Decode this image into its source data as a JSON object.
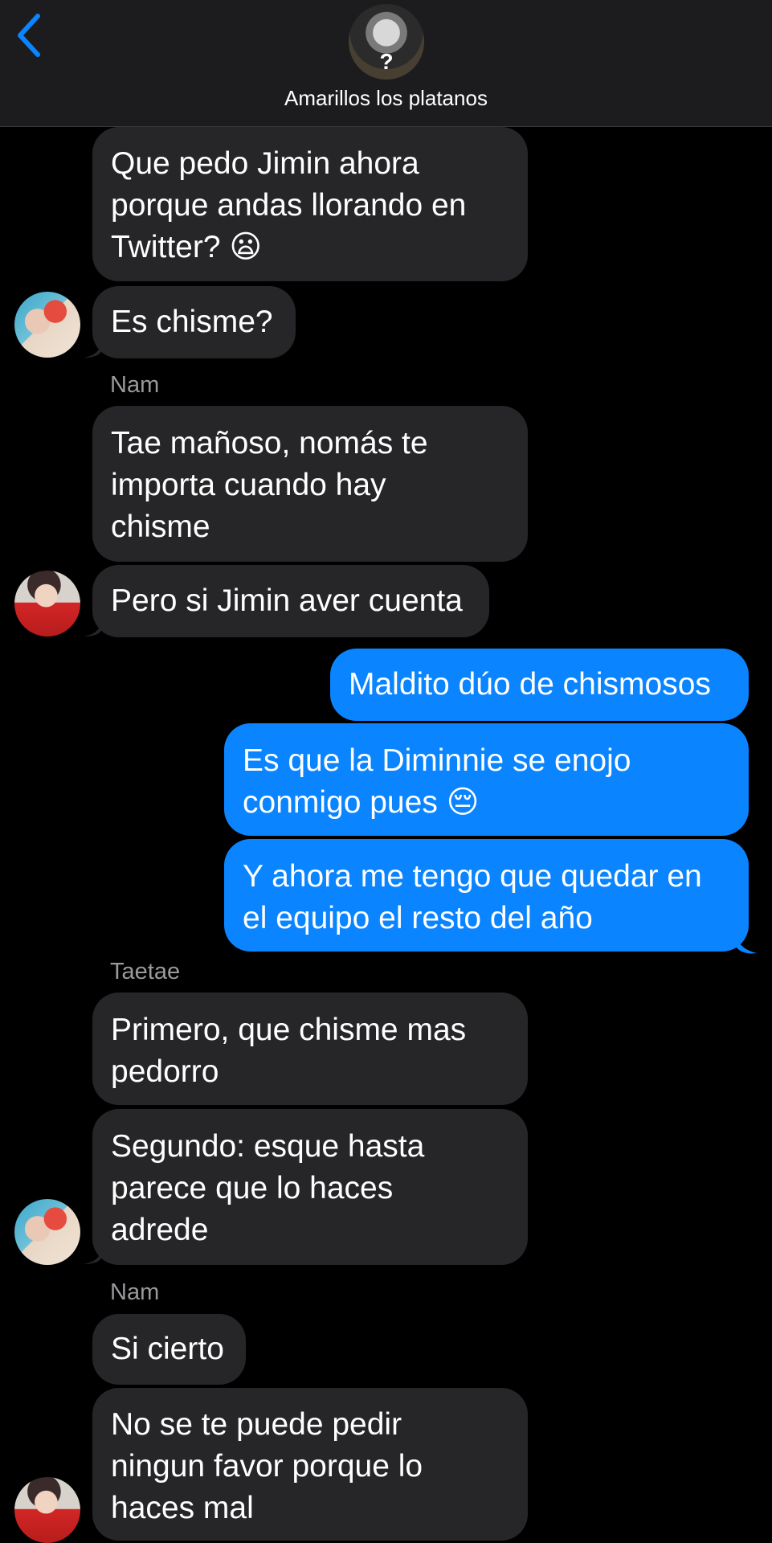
{
  "header": {
    "back_icon": "chevron-left-icon",
    "group_name": "Amarillos los platanos",
    "group_avatar_mark": "?"
  },
  "messages": [
    {
      "id": "m1",
      "direction": "incoming",
      "text": "Que pedo Jimin ahora porque andas llorando en Twitter? 😦"
    },
    {
      "id": "m2",
      "direction": "incoming",
      "text": "Es chisme?",
      "avatar": "tae"
    },
    {
      "id": "m3",
      "direction": "incoming",
      "sender": "Nam",
      "text": "Tae mañoso, nomás te importa cuando hay chisme"
    },
    {
      "id": "m4",
      "direction": "incoming",
      "text": "Pero si Jimin aver cuenta",
      "avatar": "nam"
    },
    {
      "id": "m5",
      "direction": "outgoing",
      "text": "Maldito dúo de chismosos"
    },
    {
      "id": "m6",
      "direction": "outgoing",
      "text": "Es que la Diminnie se enojo conmigo pues 😔"
    },
    {
      "id": "m7",
      "direction": "outgoing",
      "text": "Y ahora me tengo que quedar en el equipo el resto del año"
    },
    {
      "id": "m8",
      "direction": "incoming",
      "sender": "Taetae",
      "text": "Primero, que chisme mas pedorro"
    },
    {
      "id": "m9",
      "direction": "incoming",
      "text": "Segundo: esque hasta parece que lo haces adrede",
      "avatar": "tae"
    },
    {
      "id": "m10",
      "direction": "incoming",
      "sender": "Nam",
      "text": "Si cierto"
    },
    {
      "id": "m11",
      "direction": "incoming",
      "text": "No se te puede pedir ningun favor porque lo haces mal",
      "avatar": "nam"
    }
  ],
  "lines": {
    "m1": [
      "Que pedo Jimin ahora",
      "porque andas llorando en",
      "Twitter? 😦"
    ],
    "m3": [
      "Tae mañoso, nomás te",
      "importa cuando hay",
      "chisme"
    ],
    "m6": [
      "Es que la Diminnie se enojo",
      "conmigo pues 😔"
    ],
    "m7": [
      "Y ahora me tengo que quedar en",
      "el equipo el resto del año"
    ],
    "m8": [
      "Primero, que chisme mas",
      "pedorro"
    ],
    "m9": [
      "Segundo: esque hasta",
      "parece que lo haces",
      "adrede"
    ],
    "m11": [
      "No se te puede pedir",
      "ningun favor porque lo",
      "haces mal"
    ]
  },
  "colors": {
    "background": "#000000",
    "header": "#1c1c1e",
    "incoming_bubble": "#262628",
    "outgoing_bubble": "#0a84ff",
    "sender_label": "#9a9a9e",
    "accent": "#0a84ff"
  }
}
